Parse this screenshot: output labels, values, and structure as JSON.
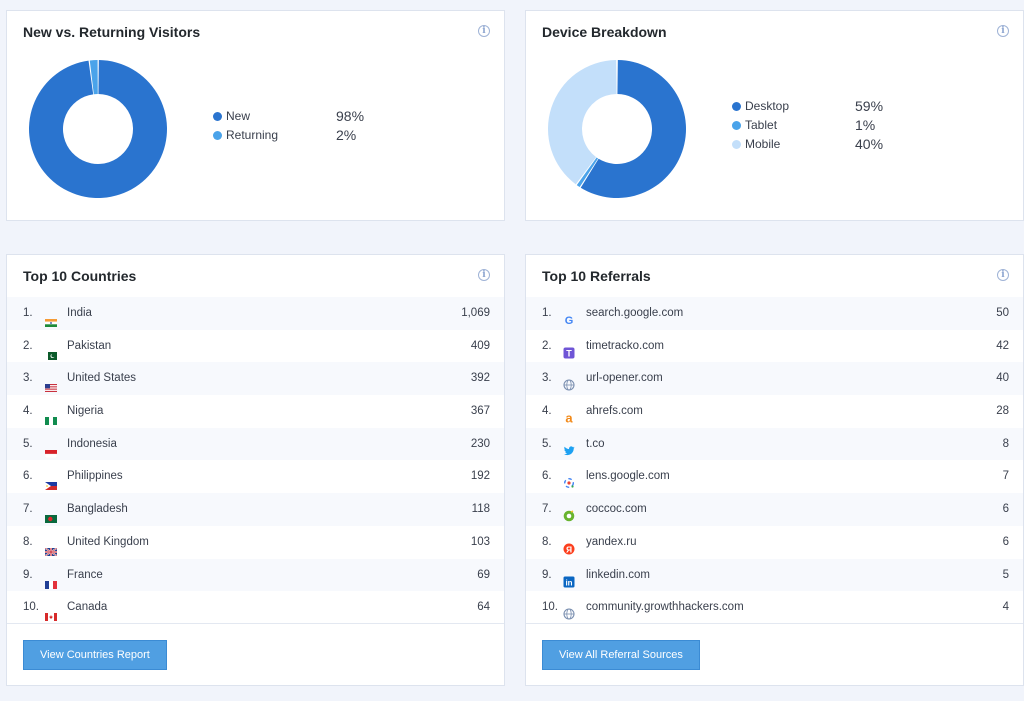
{
  "visitors": {
    "title": "New vs. Returning Visitors",
    "info_icon": "i",
    "chart_data": {
      "type": "pie",
      "categories": [
        "New",
        "Returning"
      ],
      "values": [
        98,
        2
      ],
      "colors": [
        "#2a74cf",
        "#4aa3ea"
      ]
    },
    "legend": [
      {
        "label": "New",
        "value": "98%",
        "color": "#2a74cf"
      },
      {
        "label": "Returning",
        "value": "2%",
        "color": "#4aa3ea"
      }
    ]
  },
  "devices": {
    "title": "Device Breakdown",
    "info_icon": "i",
    "chart_data": {
      "type": "pie",
      "categories": [
        "Desktop",
        "Tablet",
        "Mobile"
      ],
      "values": [
        59,
        1,
        40
      ],
      "colors": [
        "#2a74cf",
        "#4aa3ea",
        "#c3dffa"
      ]
    },
    "legend": [
      {
        "label": "Desktop",
        "value": "59%",
        "color": "#2a74cf"
      },
      {
        "label": "Tablet",
        "value": "1%",
        "color": "#4aa3ea"
      },
      {
        "label": "Mobile",
        "value": "40%",
        "color": "#c3dffa"
      }
    ]
  },
  "countries": {
    "title": "Top 10 Countries",
    "info_icon": "i",
    "button_label": "View Countries Report",
    "rows": [
      {
        "rank": "1.",
        "name": "India",
        "count": "1,069",
        "flag": "india-flag"
      },
      {
        "rank": "2.",
        "name": "Pakistan",
        "count": "409",
        "flag": "pakistan-flag"
      },
      {
        "rank": "3.",
        "name": "United States",
        "count": "392",
        "flag": "us-flag"
      },
      {
        "rank": "4.",
        "name": "Nigeria",
        "count": "367",
        "flag": "nigeria-flag"
      },
      {
        "rank": "5.",
        "name": "Indonesia",
        "count": "230",
        "flag": "indonesia-flag"
      },
      {
        "rank": "6.",
        "name": "Philippines",
        "count": "192",
        "flag": "philippines-flag"
      },
      {
        "rank": "7.",
        "name": "Bangladesh",
        "count": "118",
        "flag": "bangladesh-flag"
      },
      {
        "rank": "8.",
        "name": "United Kingdom",
        "count": "103",
        "flag": "uk-flag"
      },
      {
        "rank": "9.",
        "name": "France",
        "count": "69",
        "flag": "france-flag"
      },
      {
        "rank": "10.",
        "name": "Canada",
        "count": "64",
        "flag": "canada-flag"
      }
    ]
  },
  "referrals": {
    "title": "Top 10 Referrals",
    "info_icon": "i",
    "button_label": "View All Referral Sources",
    "rows": [
      {
        "rank": "1.",
        "name": "search.google.com",
        "count": "50",
        "icon": "google-icon"
      },
      {
        "rank": "2.",
        "name": "timetracko.com",
        "count": "42",
        "icon": "timetracko-icon"
      },
      {
        "rank": "3.",
        "name": "url-opener.com",
        "count": "40",
        "icon": "globe-icon"
      },
      {
        "rank": "4.",
        "name": "ahrefs.com",
        "count": "28",
        "icon": "ahrefs-icon"
      },
      {
        "rank": "5.",
        "name": "t.co",
        "count": "8",
        "icon": "twitter-icon"
      },
      {
        "rank": "6.",
        "name": "lens.google.com",
        "count": "7",
        "icon": "google-lens-icon"
      },
      {
        "rank": "7.",
        "name": "coccoc.com",
        "count": "6",
        "icon": "coccoc-icon"
      },
      {
        "rank": "8.",
        "name": "yandex.ru",
        "count": "6",
        "icon": "yandex-icon"
      },
      {
        "rank": "9.",
        "name": "linkedin.com",
        "count": "5",
        "icon": "linkedin-icon"
      },
      {
        "rank": "10.",
        "name": "community.growthhackers.com",
        "count": "4",
        "icon": "globe-icon"
      }
    ]
  }
}
